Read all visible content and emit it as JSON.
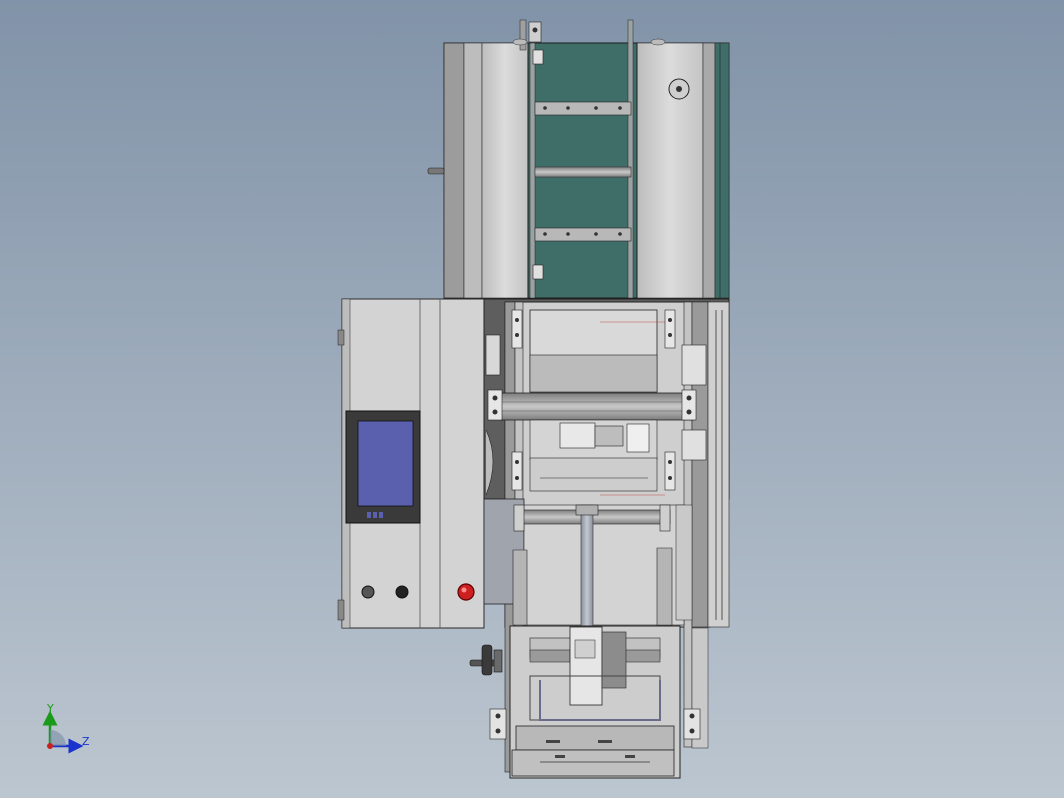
{
  "viewport": {
    "background_top": "#8193a8",
    "background_bottom": "#bcc6d0"
  },
  "model": {
    "body_color": "#d5d5d5",
    "panel_color": "#c9c9c9",
    "frame_color": "#8a8a8a",
    "glass_color": "#3f6e69",
    "screen_color": "#5a5fae",
    "estop_color": "#cc1f1f"
  },
  "triad": {
    "y_label": "Y",
    "z_label": "Z",
    "y_color": "#1a9a1a",
    "z_color": "#1a33cc",
    "origin_color": "#cc1f1f"
  }
}
